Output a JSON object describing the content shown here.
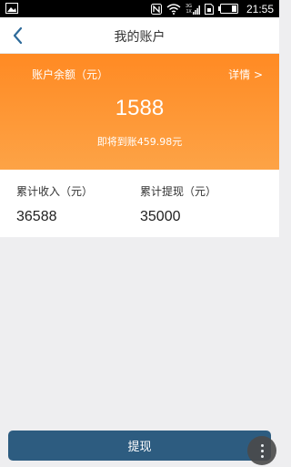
{
  "status_bar": {
    "time": "21:55",
    "network_3g": "3G",
    "network_1x": "1X",
    "icons": [
      "image-icon",
      "nfc-icon",
      "wifi-icon",
      "signal-icon",
      "sim-icon",
      "battery-icon"
    ]
  },
  "header": {
    "title": "我的账户",
    "back_icon": "chevron-left-icon"
  },
  "balance": {
    "label": "账户余额（元）",
    "details_link": "详情 >",
    "amount": "1588",
    "pending_text": "即将到账459.98元"
  },
  "stats": {
    "income_label": "累计收入（元）",
    "income_value": "36588",
    "withdrawn_label": "累计提现（元）",
    "withdrawn_value": "35000"
  },
  "actions": {
    "withdraw_label": "提现",
    "more_icon": "more-vertical-icon"
  },
  "colors": {
    "accent_orange": "#ff8a23",
    "button_blue": "#2d5c80",
    "background": "#eeeef0"
  }
}
